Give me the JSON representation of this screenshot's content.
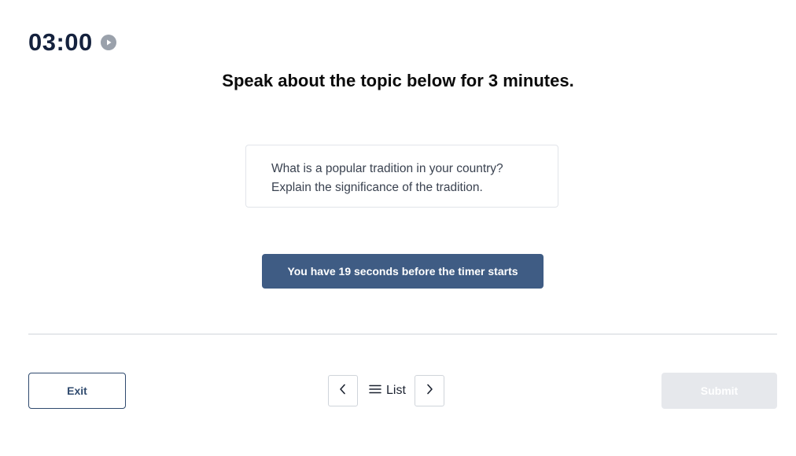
{
  "timer": {
    "value": "03:00",
    "control_icon": "play-icon"
  },
  "heading": "Speak about the topic below for 3 minutes.",
  "prompt": {
    "lines": [
      "What is a popular tradition in your country?",
      "Explain the significance of the tradition."
    ]
  },
  "countdown_banner": "You have 19 seconds before the timer starts",
  "footer": {
    "exit_label": "Exit",
    "prev_icon": "chevron-left-icon",
    "list_icon": "hamburger-icon",
    "list_label": "List",
    "next_icon": "chevron-right-icon",
    "submit_label": "Submit"
  },
  "colors": {
    "banner": "#3f5c84",
    "exit_border": "#2f4a6e",
    "submit_disabled": "#e6e8ec"
  }
}
